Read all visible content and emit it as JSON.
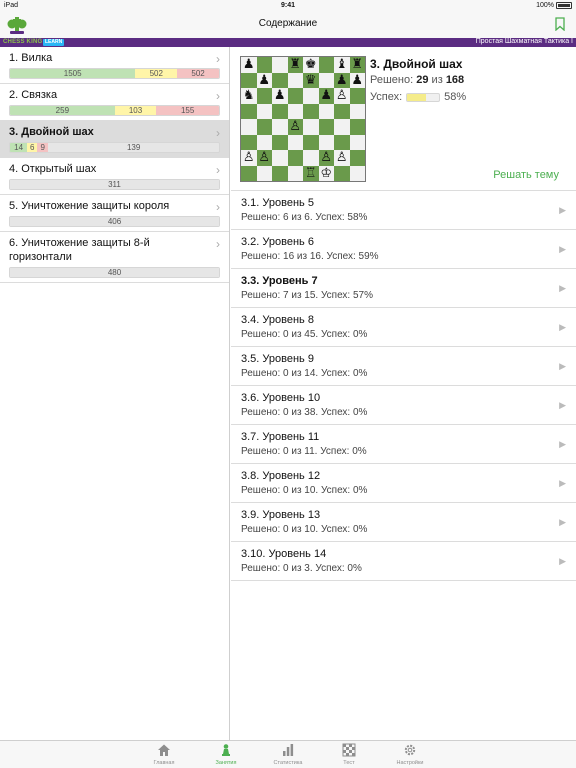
{
  "status_bar": {
    "device": "iPad",
    "time": "9:41",
    "battery": "100%"
  },
  "nav": {
    "title": "Содержание",
    "logo_icon": "chess-king-logo-icon",
    "bookmark_icon": "bookmark-icon"
  },
  "banner": {
    "brand": "CHESS KING",
    "badge": "LEARN",
    "subtitle": "Простая Шахматная Тактика I"
  },
  "topics": [
    {
      "label": "1. Вилка",
      "segments": [
        {
          "kind": "g",
          "value": "1505",
          "weight": 1505
        },
        {
          "kind": "y",
          "value": "502",
          "weight": 502
        },
        {
          "kind": "r",
          "value": "502",
          "weight": 502
        }
      ]
    },
    {
      "label": "2. Связка",
      "segments": [
        {
          "kind": "g",
          "value": "259",
          "weight": 259
        },
        {
          "kind": "y",
          "value": "103",
          "weight": 103
        },
        {
          "kind": "r",
          "value": "155",
          "weight": 155
        }
      ]
    },
    {
      "label": "3. Двойной шах",
      "selected": true,
      "segments": [
        {
          "kind": "g",
          "value": "14",
          "weight": 14
        },
        {
          "kind": "y",
          "value": "6",
          "weight": 6
        },
        {
          "kind": "r",
          "value": "9",
          "weight": 9
        },
        {
          "kind": "n",
          "value": "139",
          "weight": 139
        }
      ]
    },
    {
      "label": "4. Открытый шах",
      "segments": [
        {
          "kind": "n",
          "value": "311",
          "weight": 311
        }
      ]
    },
    {
      "label": "5. Уничтожение защиты короля",
      "segments": [
        {
          "kind": "n",
          "value": "406",
          "weight": 406
        }
      ]
    },
    {
      "label": "6. Уничтожение защиты 8-й горизонтали",
      "segments": [
        {
          "kind": "n",
          "value": "480",
          "weight": 480
        }
      ]
    }
  ],
  "theme": {
    "title": "3. Двойной шах",
    "solved_label": "Решено:",
    "solved": "29",
    "of_word": "из",
    "total": "168",
    "success_label": "Успех:",
    "success": "58%",
    "success_fraction": 0.58,
    "solve_button": "Решать тему",
    "board": [
      [
        "♟",
        "",
        "",
        "♜",
        "♚",
        "",
        "♝",
        "♜"
      ],
      [
        "",
        "♟",
        "",
        "",
        "♛",
        "",
        "♟",
        "♟"
      ],
      [
        "♞",
        "",
        "♟",
        "",
        "",
        "♟",
        "♙",
        ""
      ],
      [
        "",
        "",
        "",
        "",
        "",
        "",
        "",
        ""
      ],
      [
        "",
        "",
        "",
        "♙",
        "",
        "",
        "",
        ""
      ],
      [
        "",
        "",
        "",
        "",
        "",
        "",
        "",
        ""
      ],
      [
        "♙",
        "♙",
        "",
        "",
        "",
        "♙",
        "♙",
        ""
      ],
      [
        "",
        "",
        "",
        "",
        "♖",
        "♔",
        "",
        ""
      ]
    ]
  },
  "levels": [
    {
      "label": "3.1. Уровень 5",
      "stats": "Решено: 6 из 6. Успех: 58%"
    },
    {
      "label": "3.2. Уровень 6",
      "stats": "Решено: 16 из 16. Успех: 59%"
    },
    {
      "label": "3.3. Уровень 7",
      "stats": "Решено: 7 из 15. Успех: 57%",
      "current": true
    },
    {
      "label": "3.4. Уровень 8",
      "stats": "Решено: 0 из 45. Успех: 0%"
    },
    {
      "label": "3.5. Уровень 9",
      "stats": "Решено: 0 из 14. Успех: 0%"
    },
    {
      "label": "3.6. Уровень 10",
      "stats": "Решено: 0 из 38. Успех: 0%"
    },
    {
      "label": "3.7. Уровень 11",
      "stats": "Решено: 0 из 11. Успех: 0%"
    },
    {
      "label": "3.8. Уровень 12",
      "stats": "Решено: 0 из 10. Успех: 0%"
    },
    {
      "label": "3.9. Уровень 13",
      "stats": "Решено: 0 из 10. Успех: 0%"
    },
    {
      "label": "3.10. Уровень 14",
      "stats": "Решено: 0 из 3. Успех: 0%"
    }
  ],
  "tabs": [
    {
      "label": "Главная",
      "icon": "home-icon"
    },
    {
      "label": "Занятия",
      "icon": "pawn-icon",
      "active": true
    },
    {
      "label": "Статистика",
      "icon": "bar-chart-icon"
    },
    {
      "label": "Тест",
      "icon": "chessboard-icon"
    },
    {
      "label": "Настройки",
      "icon": "gear-icon"
    }
  ],
  "colors": {
    "accent": "#4caf50",
    "banner": "#5b2c82",
    "board_dark": "#6a9a4b"
  }
}
